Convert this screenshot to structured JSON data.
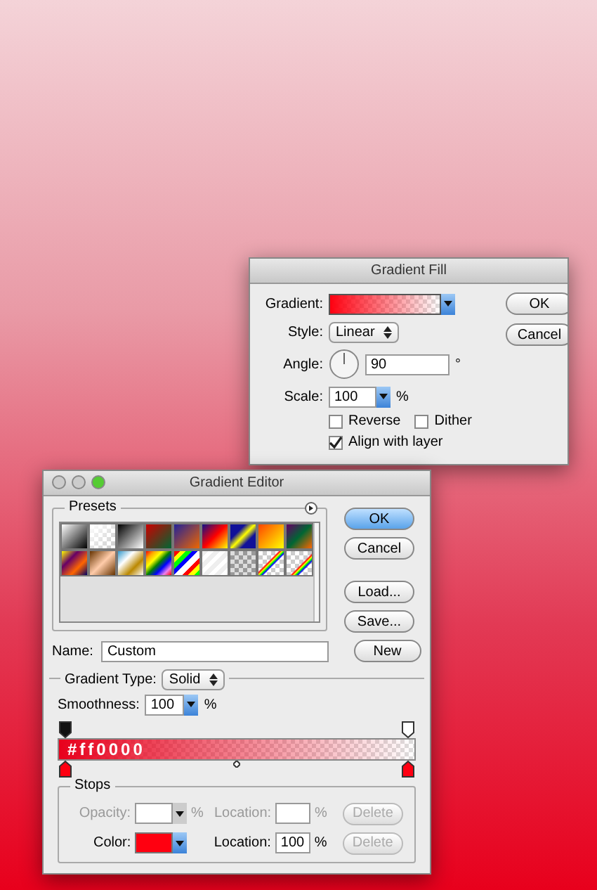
{
  "gradient_fill": {
    "title": "Gradient Fill",
    "gradient_label": "Gradient:",
    "style_label": "Style:",
    "style_value": "Linear",
    "angle_label": "Angle:",
    "angle_value": "90",
    "angle_unit": "°",
    "scale_label": "Scale:",
    "scale_value": "100",
    "scale_unit": "%",
    "checkboxes": [
      {
        "label": "Reverse",
        "checked": false
      },
      {
        "label": "Dither",
        "checked": false
      },
      {
        "label": "Align with layer",
        "checked": true
      }
    ],
    "buttons": [
      "OK",
      "Cancel"
    ]
  },
  "gradient_editor": {
    "title": "Gradient Editor",
    "presets_label": "Presets",
    "buttons": [
      "OK",
      "Cancel",
      "Load...",
      "Save..."
    ],
    "name_label": "Name:",
    "name_value": "Custom",
    "new_button": "New",
    "gradient_type_label": "Gradient Type:",
    "gradient_type_value": "Solid",
    "smoothness_label": "Smoothness:",
    "smoothness_value": "100",
    "smoothness_unit": "%",
    "bar_text": "#ff0000",
    "stops": {
      "label": "Stops",
      "rows": [
        {
          "label": "Opacity:",
          "unit": "%",
          "location_label": "Location:",
          "location_value": "",
          "location_unit": "%",
          "delete": "Delete",
          "disabled": true,
          "kind": "opacity"
        },
        {
          "label": "Color:",
          "color": "#ff0010",
          "location_label": "Location:",
          "location_value": "100",
          "location_unit": "%",
          "delete": "Delete",
          "disabled": false,
          "kind": "color"
        }
      ]
    }
  }
}
